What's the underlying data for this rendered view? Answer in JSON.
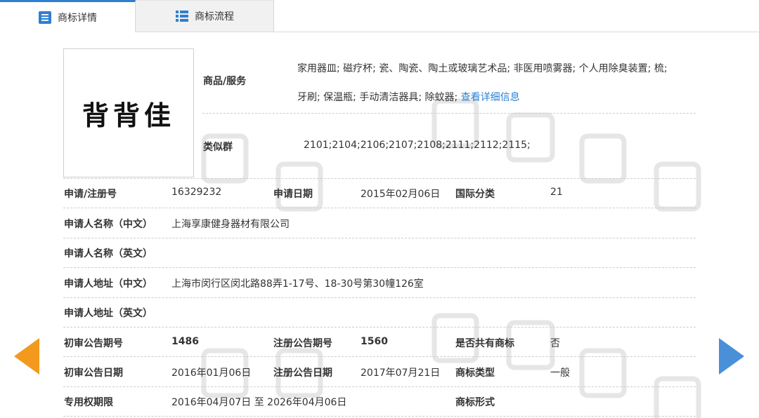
{
  "tabs": [
    {
      "label": "商标详情",
      "icon": "list-doc-icon"
    },
    {
      "label": "商标流程",
      "icon": "grid-list-icon"
    }
  ],
  "logo_text": "背背佳",
  "goods": {
    "label": "商品/服务",
    "line1": "家用器皿; 磁疗杯; 瓷、陶瓷、陶土或玻璃艺术品; 非医用喷雾器; 个人用除臭装置; 梳;",
    "line2": "牙刷; 保温瓶; 手动清洁器具; 除蚊器; ",
    "link": "查看详细信息"
  },
  "similar_group": {
    "label": "类似群",
    "value": "2101;2104;2106;2107;2108;2111;2112;2115;"
  },
  "row_reg": {
    "reg_no_label": "申请/注册号",
    "reg_no": "16329232",
    "apply_date_label": "申请日期",
    "apply_date": "2015年02月06日",
    "intl_class_label": "国际分类",
    "intl_class": "21"
  },
  "applicant_cn": {
    "label": "申请人名称（中文）",
    "value": "上海享康健身器材有限公司"
  },
  "applicant_en": {
    "label": "申请人名称（英文）",
    "value": ""
  },
  "address_cn": {
    "label": "申请人地址（中文）",
    "value": "上海市闵行区闵北路88弄1-17号、18-30号第30幢126室"
  },
  "address_en": {
    "label": "申请人地址（英文）",
    "value": ""
  },
  "row_pub_no": {
    "prelim_no_label": "初审公告期号",
    "prelim_no": "1486",
    "reg_no_label": "注册公告期号",
    "reg_no": "1560",
    "shared_label": "是否共有商标",
    "shared": "否"
  },
  "row_pub_date": {
    "prelim_date_label": "初审公告日期",
    "prelim_date": "2016年01月06日",
    "reg_date_label": "注册公告日期",
    "reg_date": "2017年07月21日",
    "type_label": "商标类型",
    "type": "一般"
  },
  "row_period": {
    "period_label": "专用权期限",
    "period": "2016年04月07日 至 2026年04月06日",
    "form_label": "商标形式",
    "form": ""
  },
  "nav": {
    "prev_icon": "arrow-left-icon",
    "next_icon": "arrow-right-icon"
  },
  "colors": {
    "accent": "#2f7fd0",
    "link": "#2a7fd4",
    "prev_arrow": "#f39a1e",
    "next_arrow": "#4a90d9"
  }
}
